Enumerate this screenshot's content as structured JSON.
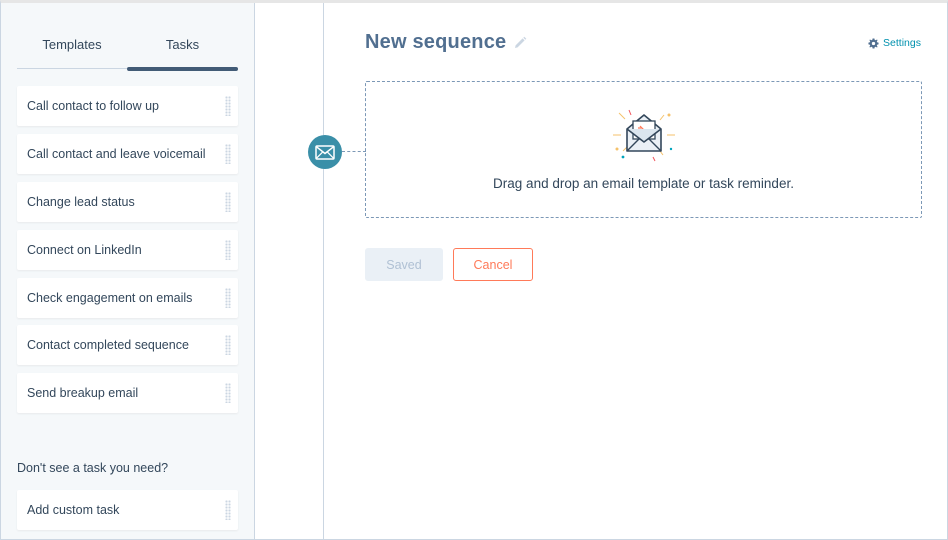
{
  "sidebar": {
    "tabs": [
      {
        "label": "Templates",
        "active": false
      },
      {
        "label": "Tasks",
        "active": true
      }
    ],
    "tasks": [
      {
        "label": "Call contact to follow up"
      },
      {
        "label": "Call contact and leave voicemail"
      },
      {
        "label": "Change lead status"
      },
      {
        "label": "Connect on LinkedIn"
      },
      {
        "label": "Check engagement on emails"
      },
      {
        "label": "Contact completed sequence"
      },
      {
        "label": "Send breakup email"
      }
    ],
    "custom_question": "Don't see a task you need?",
    "custom_task": "Add custom task"
  },
  "main": {
    "title": "New sequence",
    "settings_label": "Settings",
    "dropzone_text": "Drag and drop an email template or task reminder.",
    "saved_label": "Saved",
    "cancel_label": "Cancel"
  },
  "icons": {
    "step_node": "envelope-icon",
    "title_edit": "pencil-icon",
    "settings": "gear-icon",
    "illustration": "open-envelope-illustration"
  },
  "colors": {
    "accent_teal": "#3a8fa8",
    "link": "#0091ae",
    "cancel": "#ff7a59",
    "tab_underline": "#425b76"
  }
}
